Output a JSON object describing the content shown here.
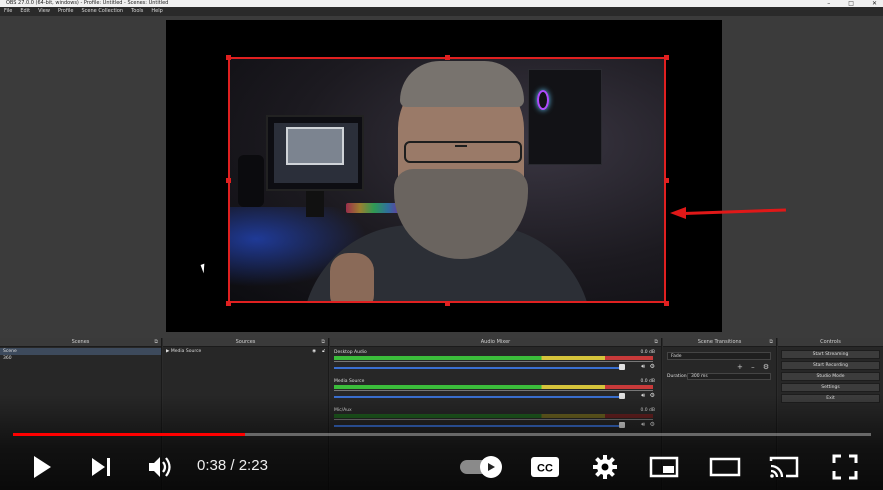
{
  "obs": {
    "titlebar": "OBS 27.0.0 (64-bit, windows) - Profile: Untitled - Scenes: Untitled",
    "window_controls": [
      "–",
      "□",
      "✕"
    ],
    "menu": [
      "File",
      "Edit",
      "View",
      "Profile",
      "Scene Collection",
      "Tools",
      "Help"
    ],
    "docks": {
      "scenes": {
        "title": "Scenes",
        "items": [
          "Scene",
          "360"
        ]
      },
      "sources": {
        "title": "Sources",
        "items": [
          "Media Source"
        ]
      },
      "mixer": {
        "title": "Audio Mixer",
        "channels": [
          {
            "name": "Desktop Audio",
            "db": "0.0 dB"
          },
          {
            "name": "Media Source",
            "db": "0.0 dB"
          },
          {
            "name": "Mic/Aux",
            "db": "0.0 dB"
          }
        ]
      },
      "transitions": {
        "title": "Scene Transitions",
        "selected": "Fade",
        "duration_label": "Duration",
        "duration_value": "300 ms",
        "tools": "+ – ⚙"
      },
      "controls": {
        "title": "Controls",
        "buttons": [
          "Start Streaming",
          "Start Recording",
          "Studio Mode",
          "Settings",
          "Exit"
        ]
      }
    }
  },
  "player": {
    "progress": 0.2705,
    "accent": "#ff0000",
    "current_time": "0:38",
    "separator": " / ",
    "duration": "2:23",
    "time_display": "0:38 / 2:23",
    "autoplay_on": true,
    "icons": [
      "play-icon",
      "next-icon",
      "volume-icon",
      "autoplay-toggle",
      "cc-icon",
      "settings-icon",
      "miniplayer-icon",
      "theater-icon",
      "cast-icon",
      "fullscreen-icon"
    ]
  }
}
